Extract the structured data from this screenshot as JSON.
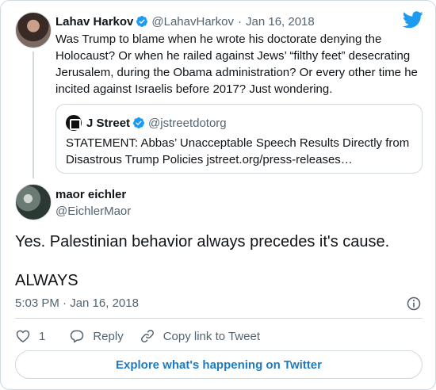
{
  "brand": {
    "accent": "#1d9bf0",
    "link": "#1d7bc0",
    "muted": "#536471",
    "border": "#cfd9de"
  },
  "parent_tweet": {
    "name": "Lahav Harkov",
    "handle": "@LahavHarkov",
    "separator": "·",
    "date": "Jan 16, 2018",
    "text": "Was Trump to blame when he wrote his doctorate denying the Holocaust? Or when he railed against Jews’ “filthy feet” desecrating Jerusalem, during the Obama administration? Or every other time he incited against Israelis before 2017? Just wondering.",
    "quoted": {
      "name": "J Street",
      "handle": "@jstreetdotorg",
      "text": "STATEMENT: Abbas’ Unacceptable Speech Results Directly from Disastrous Trump Policies jstreet.org/press-releases…"
    }
  },
  "main_tweet": {
    "name": "maor eichler",
    "handle": "@EichlerMaor",
    "text_line1": "Yes. Palestinian behavior always precedes it's cause.",
    "text_line2": "ALWAYS",
    "timestamp": "5:03 PM · Jan 16, 2018"
  },
  "actions": {
    "like_count": "1",
    "reply_label": "Reply",
    "copy_link_label": "Copy link to Tweet"
  },
  "explore_label": "Explore what's happening on Twitter",
  "icons": [
    "verified-badge-icon",
    "twitter-bird-icon",
    "info-icon",
    "heart-icon",
    "reply-icon",
    "link-icon"
  ]
}
